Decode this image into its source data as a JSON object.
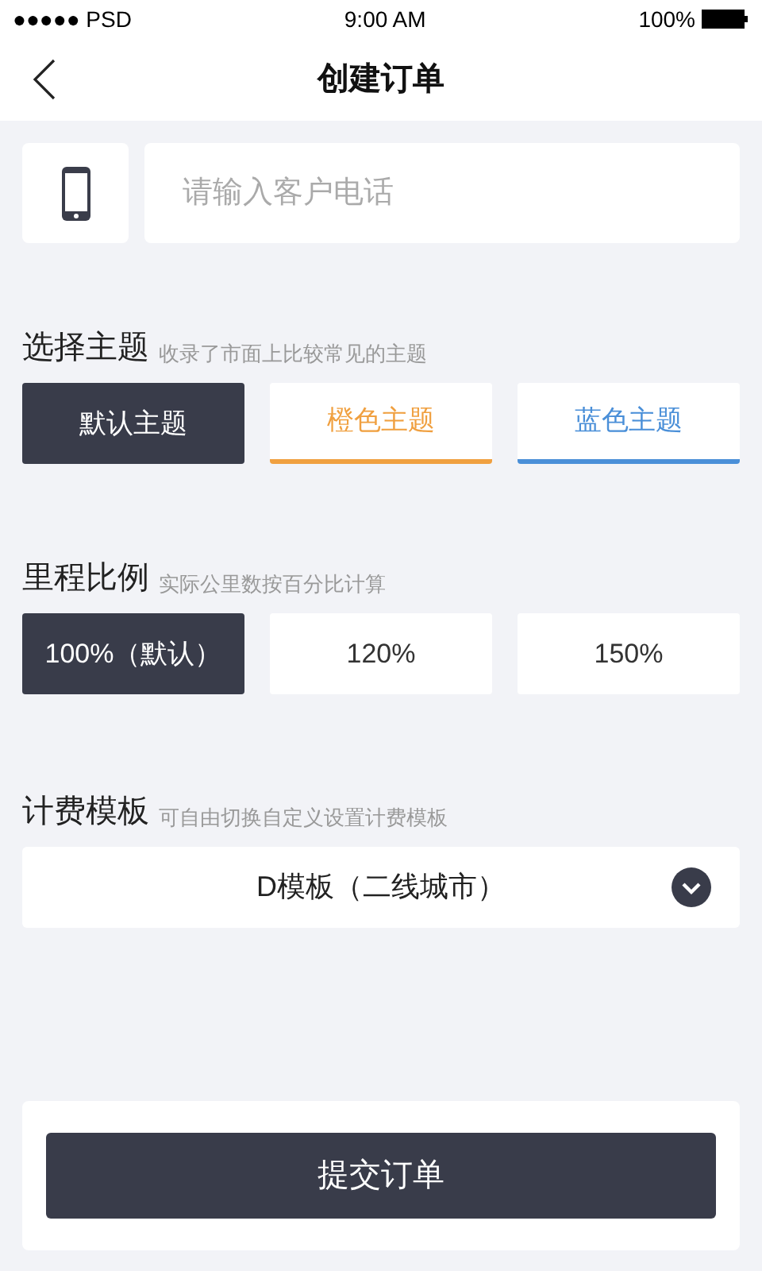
{
  "status_bar": {
    "carrier": "●●●●● PSD",
    "time": "9:00 AM",
    "battery": "100%"
  },
  "nav": {
    "title": "创建订单"
  },
  "phone_field": {
    "placeholder": "请输入客户电话"
  },
  "theme_section": {
    "title": "选择主题",
    "hint": "收录了市面上比较常见的主题",
    "options": [
      {
        "label": "默认主题",
        "selected": true
      },
      {
        "label": "橙色主题",
        "selected": false,
        "color": "#f0a040"
      },
      {
        "label": "蓝色主题",
        "selected": false,
        "color": "#4a8fd8"
      }
    ]
  },
  "mileage_section": {
    "title": "里程比例",
    "hint": "实际公里数按百分比计算",
    "options": [
      {
        "label": "100%（默认）",
        "selected": true
      },
      {
        "label": "120%",
        "selected": false
      },
      {
        "label": "150%",
        "selected": false
      }
    ]
  },
  "template_section": {
    "title": "计费模板",
    "hint": "可自由切换自定义设置计费模板",
    "value": "D模板（二线城市）"
  },
  "submit_button": "提交订单"
}
